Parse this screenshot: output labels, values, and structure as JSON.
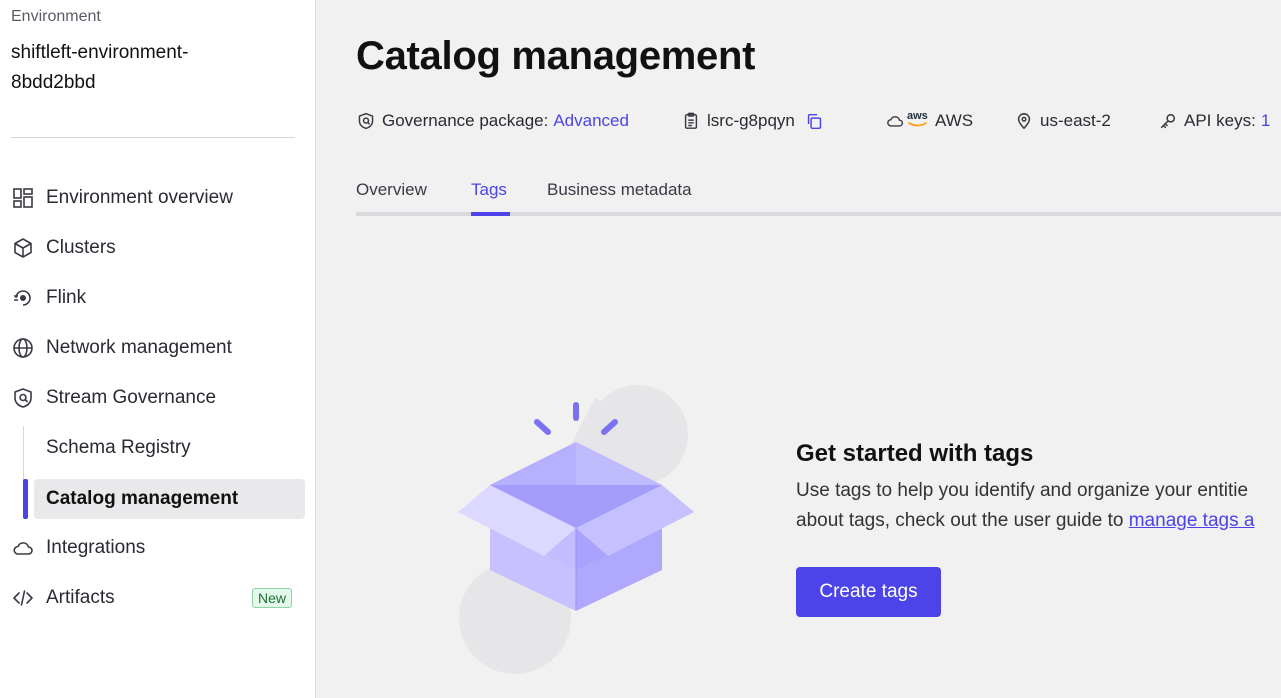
{
  "sidebar": {
    "env_label": "Environment",
    "env_name": "shiftleft-environment-8bdd2bbd",
    "items": [
      {
        "label": "Environment overview",
        "icon": "dashboard-icon"
      },
      {
        "label": "Clusters",
        "icon": "cube-icon"
      },
      {
        "label": "Flink",
        "icon": "flink-icon"
      },
      {
        "label": "Network management",
        "icon": "globe-icon"
      },
      {
        "label": "Stream Governance",
        "icon": "governance-shield-icon"
      },
      {
        "label": "Schema Registry",
        "icon": ""
      },
      {
        "label": "Catalog management",
        "icon": "",
        "active": true
      },
      {
        "label": "Integrations",
        "icon": "cloud-icon"
      },
      {
        "label": "Artifacts",
        "icon": "code-icon",
        "badge": "New"
      }
    ]
  },
  "main": {
    "title": "Catalog management",
    "meta": {
      "governance_label": "Governance package:",
      "governance_value": "Advanced",
      "cluster_id": "lsrc-g8pqyn",
      "provider_logo": "aws",
      "provider": "AWS",
      "region": "us-east-2",
      "api_keys_label": "API keys:",
      "api_keys_count": "1"
    },
    "tabs": [
      {
        "label": "Overview"
      },
      {
        "label": "Tags",
        "active": true
      },
      {
        "label": "Business metadata"
      }
    ],
    "empty_state": {
      "title": "Get started with tags",
      "line1": "Use tags to help you identify and organize your entitie",
      "line2_prefix": "about tags, check out the user guide to ",
      "line2_link": "manage tags a",
      "cta": "Create tags"
    }
  },
  "colors": {
    "accent": "#4c44e8",
    "new_badge_bg": "#e3f7ea",
    "new_badge_text": "#1e6e3a"
  }
}
